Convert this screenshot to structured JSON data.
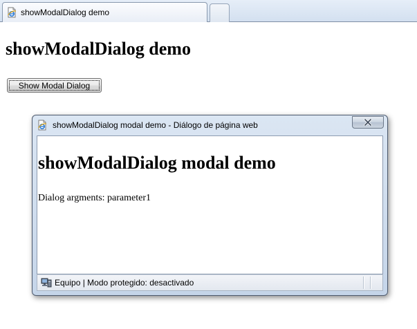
{
  "browser": {
    "tab": {
      "title": "showModalDialog demo",
      "icon": "ie-page-icon"
    },
    "new_tab_icon": "new-tab"
  },
  "page": {
    "title": "showModalDialog demo",
    "button_label": "Show Modal Dialog"
  },
  "dialog": {
    "title": "showModalDialog modal demo - Diálogo de página web",
    "close_icon": "close-x",
    "heading": "showModalDialog modal demo",
    "arguments_text": "Dialog argments: parameter1",
    "status": {
      "text": "Equipo | Modo protegido: desactivado",
      "icon": "computer-icon"
    }
  },
  "colors": {
    "dialog_frame": "#c5d5e9",
    "tabstrip": "#d3e0f0",
    "page_background": "#ffffff"
  }
}
